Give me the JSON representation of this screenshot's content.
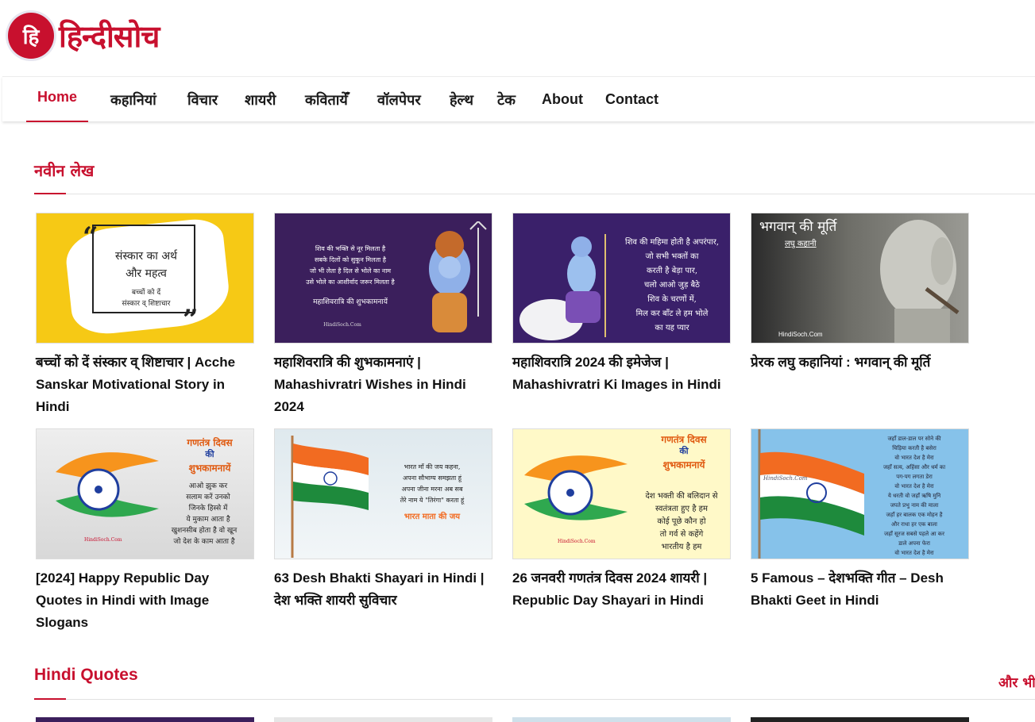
{
  "site": {
    "logo_letter": "हि",
    "logo_text": "हिन्दीसोच"
  },
  "nav": {
    "items": [
      {
        "label": "Home",
        "active": true
      },
      {
        "label": "कहानियां"
      },
      {
        "label": "विचार"
      },
      {
        "label": "शायरी"
      },
      {
        "label": "कवितायेँ"
      },
      {
        "label": "वॉलपेपर"
      },
      {
        "label": "हेल्थ"
      },
      {
        "label": "टेक"
      },
      {
        "label": "About"
      },
      {
        "label": "Contact"
      }
    ]
  },
  "latest": {
    "heading": "नवीन लेख",
    "cards": [
      {
        "title": "बच्चों को दें संस्कार व् शिष्टाचार | Acche Sanskar Motivational Story in Hindi",
        "thumb": {
          "lines": [
            "संस्कार का अर्थ",
            "और महत्व",
            "बच्चों को दें",
            "संस्कार व् शिष्टाचार"
          ],
          "quote_open": "“",
          "quote_close": "”"
        }
      },
      {
        "title": "महाशिवरात्रि की शुभकामनाएं | Mahashivratri Wishes in Hindi 2024",
        "thumb": {
          "lines": [
            "शिव की भक्ति से नूर मिलता है",
            "सबके दिलों को सुकून मिलता है",
            "जो भी लेता है दिल से भोले का नाम",
            "उसे भोले का आशीर्वाद जरूर मिलता है",
            "महाशिवरात्रि की शुभकामनायें"
          ],
          "watermark": "HindiSoch.Com"
        }
      },
      {
        "title": "महाशिवरात्रि 2024 की इमेजेज | Mahashivratri Ki Images in Hindi",
        "thumb": {
          "lines": [
            "शिव की महिमा होती है अपरंपार,",
            "जो सभी भक्तों का",
            "करती है बेड़ा पार,",
            "चलो आओ जुड़ बैठे",
            "शिव के चरणों में,",
            "मिल कर बाँट ले हम भोले",
            "का यह प्यार"
          ]
        }
      },
      {
        "title": "प्रेरक लघु कहानियां : भगवान् की मूर्ति",
        "thumb": {
          "lines": [
            "भगवान् की मूर्ति",
            "लघु कहानी"
          ],
          "watermark": "HindiSoch.Com"
        }
      },
      {
        "title": "[2024] Happy Republic Day Quotes in Hindi with Image Slogans",
        "thumb": {
          "lines": [
            "गणतंत्र दिवस",
            "की",
            "शुभकामनायें",
            "आओ झुक कर",
            "सलाम करें उनको",
            "जिनके हिस्से में",
            "ये मुकाम आता है",
            "खुशनसीब होता है वो खून",
            "जो देश के काम आता है"
          ],
          "watermark": "HindiSoch.Com"
        }
      },
      {
        "title": "63 Desh Bhakti Shayari in Hindi | देश भक्ति शायरी सुविचार",
        "thumb": {
          "lines": [
            "भारत माँ की जय कहना,",
            "अपना सौभाग्य समझता हूं",
            "अपना जीना मरना अब सब",
            "तेरे नाम ये \"तिरंगा\" करता हूं",
            "भारत माता की जय"
          ]
        }
      },
      {
        "title": "26 जनवरी गणतंत्र दिवस 2024 शायरी | Republic Day Shayari in Hindi",
        "thumb": {
          "lines": [
            "गणतंत्र दिवस",
            "की",
            "शुभकामनायें",
            "देश भक्ती की बलिदान से",
            "स्वतंत्रता हुए है हम",
            "कोई पूछे कौन हो",
            "तो गर्व से कहेंगे",
            "भारतीय है हम"
          ],
          "watermark": "HindiSoch.Com"
        }
      },
      {
        "title": "5 Famous – देशभक्ति गीत – Desh Bhakti Geet in Hindi",
        "thumb": {
          "lines": [
            "जहाँ डाल-डाल पर सोने की",
            "चिड़िया करती है बसेरा",
            "वो भारत देश है मेरा",
            "जहाँ सत्य, अहिंसा और धर्म का",
            "पग-पग लगता डेरा",
            "वो भारत देश है मेरा",
            "ये धरती वो जहाँ ऋषि मुनि",
            "जपते प्रभु नाम की माला",
            "जहाँ हर बालक एक मोहन है",
            "और राधा हर एक बाला",
            "जहाँ सूरज सबसे पहले आ कर",
            "डाले अपना फेरा",
            "वो भारत देश है मेरा"
          ],
          "watermark": "HindiSoch.Com"
        }
      }
    ]
  },
  "quotes": {
    "heading": "Hindi Quotes",
    "more_label": "और भी"
  },
  "colors": {
    "accent": "#c8102e"
  }
}
